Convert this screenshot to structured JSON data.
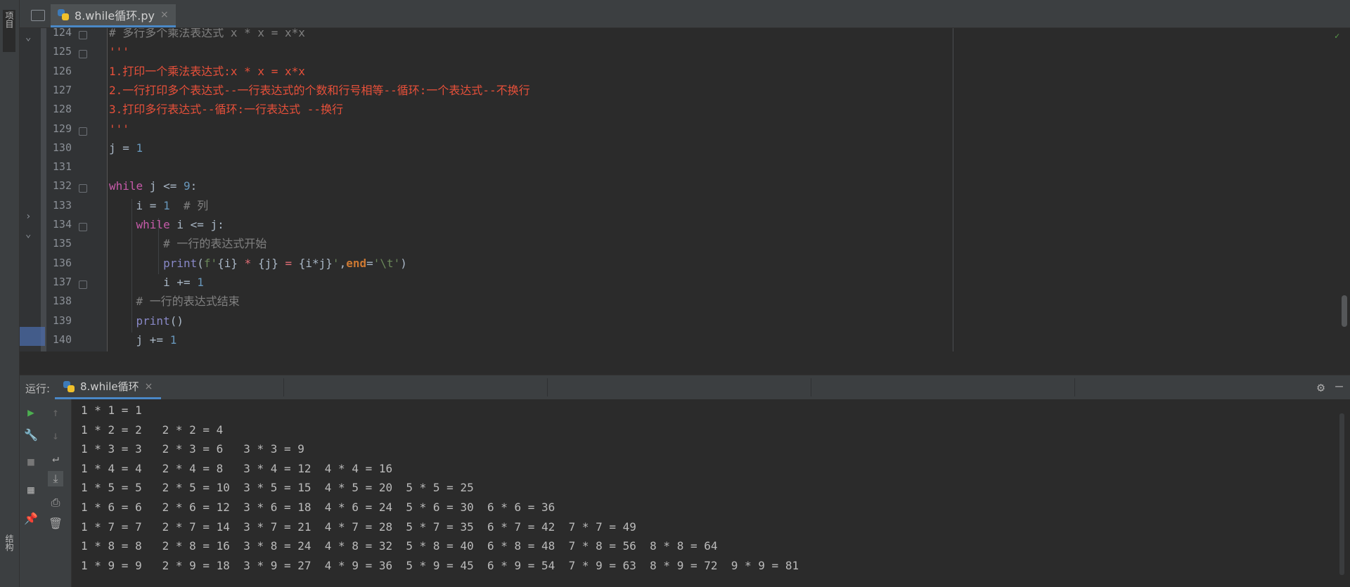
{
  "left_panel": {
    "top_tab": "项目",
    "bottom_tab": "结构"
  },
  "editor_tab": {
    "label": "8.while循环.py",
    "close": "×"
  },
  "lines": [
    {
      "n": "124",
      "html": "<span class=\"cmt\"># 多行多个乘法表达式 x * x = x*x</span>"
    },
    {
      "n": "125",
      "html": "<span class=\"doc\">'''</span>"
    },
    {
      "n": "126",
      "html": "<span class=\"doc\">1.打印一个乘法表达式:x * x = x*x</span>"
    },
    {
      "n": "127",
      "html": "<span class=\"doc\">2.一行打印多个表达式--一行表达式的个数和行号相等--循环:一个表达式--不换行</span>"
    },
    {
      "n": "128",
      "html": "<span class=\"doc\">3.打印多行表达式--循环:一行表达式 --换行</span>"
    },
    {
      "n": "129",
      "html": "<span class=\"doc\">'''</span>"
    },
    {
      "n": "130",
      "html": "j = <span class=\"num\">1</span>"
    },
    {
      "n": "131",
      "html": ""
    },
    {
      "n": "132",
      "html": "<span class=\"kw2\">while</span> j &lt;= <span class=\"num\">9</span>:"
    },
    {
      "n": "133",
      "html": "    i = <span class=\"num\">1</span>  <span class=\"cmt\"># 列</span>"
    },
    {
      "n": "134",
      "html": "    <span class=\"kw2\">while</span> i &lt;= j:"
    },
    {
      "n": "135",
      "html": "        <span class=\"cmt\"># 一行的表达式开始</span>"
    },
    {
      "n": "136",
      "html": "        <span class=\"fn\">print</span>(<span class=\"str\">f'</span>{i} <span class=\"op\">*</span> {j} <span class=\"op\">=</span> {i*j}<span class=\"str\">'</span>,<span class=\"kw\">end</span>=<span class=\"str\">'\\t'</span>)"
    },
    {
      "n": "137",
      "html": "        i += <span class=\"num\">1</span>"
    },
    {
      "n": "138",
      "html": "    <span class=\"cmt\"># 一行的表达式结束</span>"
    },
    {
      "n": "139",
      "html": "    <span class=\"fn\">print</span>()"
    },
    {
      "n": "140",
      "html": "    j += <span class=\"num\">1</span>"
    }
  ],
  "run_panel": {
    "label": "运行:",
    "tab_label": "8.while循环",
    "close": "×"
  },
  "output": [
    "1 * 1 = 1",
    "1 * 2 = 2   2 * 2 = 4",
    "1 * 3 = 3   2 * 3 = 6   3 * 3 = 9",
    "1 * 4 = 4   2 * 4 = 8   3 * 4 = 12  4 * 4 = 16",
    "1 * 5 = 5   2 * 5 = 10  3 * 5 = 15  4 * 5 = 20  5 * 5 = 25",
    "1 * 6 = 6   2 * 6 = 12  3 * 6 = 18  4 * 6 = 24  5 * 6 = 30  6 * 6 = 36",
    "1 * 7 = 7   2 * 7 = 14  3 * 7 = 21  4 * 7 = 28  5 * 7 = 35  6 * 7 = 42  7 * 7 = 49",
    "1 * 8 = 8   2 * 8 = 16  3 * 8 = 24  4 * 8 = 32  5 * 8 = 40  6 * 8 = 48  7 * 8 = 56  8 * 8 = 64",
    "1 * 9 = 9   2 * 9 = 18  3 * 9 = 27  4 * 9 = 36  5 * 9 = 45  6 * 9 = 54  7 * 9 = 63  8 * 9 = 72  9 * 9 = 81"
  ],
  "icons": {
    "rerun": "run-icon",
    "wrench": "wrench-icon",
    "stop": "stop-icon",
    "layout": "layout-icon",
    "pin": "pin-icon",
    "up": "arrow-up-icon",
    "down": "arrow-down-icon",
    "wrap": "soft-wrap-icon",
    "scroll_end": "scroll-to-end-icon",
    "print": "print-icon",
    "trash": "trash-icon",
    "gear": "gear-icon",
    "minimize": "minimize-icon"
  }
}
